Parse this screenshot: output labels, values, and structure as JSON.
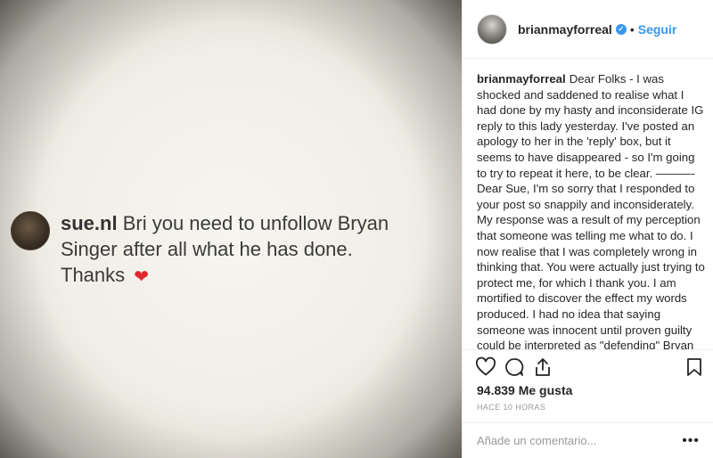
{
  "post_image": {
    "comment": {
      "username": "sue.nl",
      "text": "Bri you need to unfollow Bryan Singer after all what he has done. Thanks",
      "heart": "❤"
    }
  },
  "header": {
    "username": "brianmayforreal",
    "separator": "•",
    "follow_label": "Seguir",
    "verified_icon": "verified-badge-icon"
  },
  "caption": {
    "username": "brianmayforreal",
    "paragraph_1": "Dear Folks - I was shocked and saddened to realise what I had done by my hasty and inconsiderate IG reply to this lady yesterday. I've posted an apology to her in the 'reply' box, but it seems to have disappeared - so I'm going to try to repeat it here, to be clear. ———-",
    "paragraph_2": "Dear Sue, I'm so sorry that I responded to your post so snappily and inconsiderately. My response was a result of my perception that someone was telling me what to do. I now realise that I was completely wrong in thinking that. You were actually just trying to protect me, for which I thank you. I am mortified to discover the effect my words produced. I had no idea that saying someone was innocent until proven guilty could be interpreted as \"defending\" Bryan Singer. I had absolutely no intention of doing that. I guess I must be naive, because"
  },
  "actions": {
    "icons": [
      "heart-icon",
      "comment-icon",
      "share-icon",
      "bookmark-icon"
    ]
  },
  "likes_text": "94.839 Me gusta",
  "timestamp": "HACE 10 HORAS",
  "add_comment": {
    "placeholder": "Añade un comentario...",
    "more_label": "•••"
  },
  "colors": {
    "accent": "#3897f0",
    "heart": "#e0262e",
    "text": "#262626",
    "muted": "#999999"
  }
}
